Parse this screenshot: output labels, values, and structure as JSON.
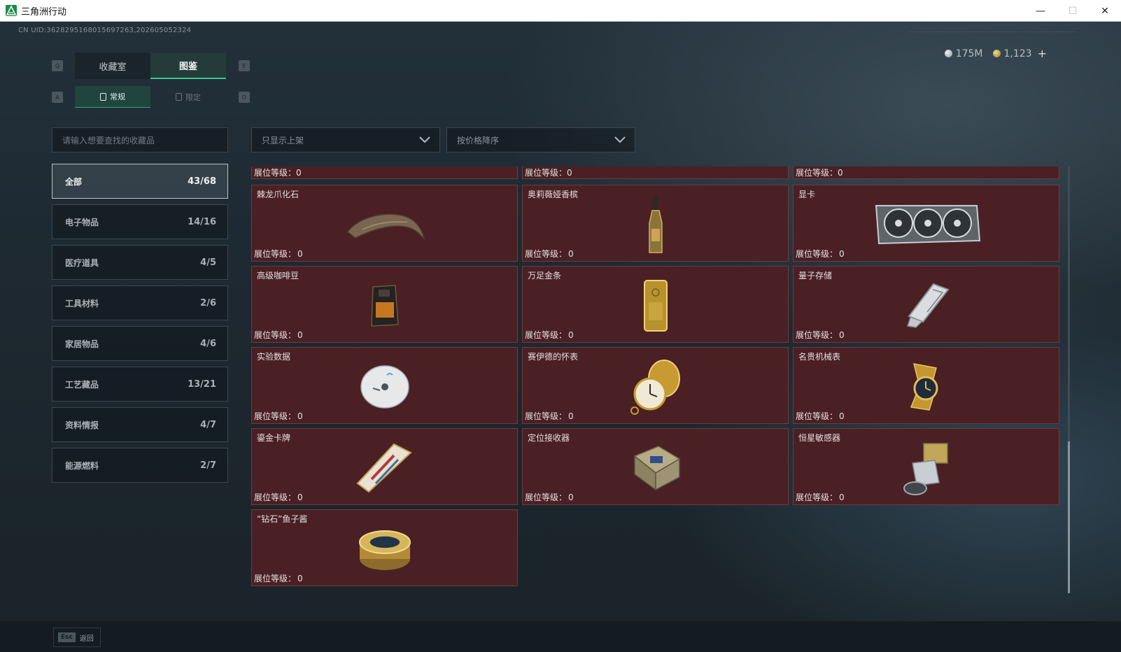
{
  "window": {
    "title": "三角洲行动",
    "minimize": "—",
    "maximize": "☐",
    "close": "✕"
  },
  "uid": "CN UID:3628295168015697263,202605052324",
  "currency": {
    "silver": "175M",
    "gold": "1,123",
    "plus": "+"
  },
  "keys": {
    "q": "Q",
    "e": "E",
    "a": "A",
    "d": "D",
    "esc": "Esc"
  },
  "tabs": {
    "main": [
      "收藏室",
      "图鉴"
    ],
    "sub": [
      "常规",
      "限定"
    ]
  },
  "search": {
    "placeholder": "请输入想要查找的收藏品"
  },
  "filters": {
    "shelf": "只显示上架",
    "sort": "按价格降序"
  },
  "categories": [
    {
      "label": "全部",
      "count": "43/68"
    },
    {
      "label": "电子物品",
      "count": "14/16"
    },
    {
      "label": "医疗道具",
      "count": "4/5"
    },
    {
      "label": "工具材料",
      "count": "2/6"
    },
    {
      "label": "家居物品",
      "count": "4/6"
    },
    {
      "label": "工艺藏品",
      "count": "13/21"
    },
    {
      "label": "资料情报",
      "count": "4/7"
    },
    {
      "label": "能源燃料",
      "count": "2/7"
    }
  ],
  "level_label": "展位等级：",
  "level_value": "0",
  "items": [
    {
      "name": "棘龙爪化石",
      "icon": "claw-fossil-icon"
    },
    {
      "name": "奥莉薇娅香槟",
      "icon": "champagne-icon"
    },
    {
      "name": "显卡",
      "icon": "graphics-card-icon"
    },
    {
      "name": "高级咖啡豆",
      "icon": "coffee-bag-icon"
    },
    {
      "name": "万足金条",
      "icon": "gold-bar-icon"
    },
    {
      "name": "量子存储",
      "icon": "quantum-storage-icon"
    },
    {
      "name": "实验数据",
      "icon": "disc-icon"
    },
    {
      "name": "赛伊德的怀表",
      "icon": "pocket-watch-icon"
    },
    {
      "name": "名贵机械表",
      "icon": "wristwatch-icon"
    },
    {
      "name": "鎏金卡牌",
      "icon": "gilded-card-icon"
    },
    {
      "name": "定位接收器",
      "icon": "gps-receiver-icon"
    },
    {
      "name": "恒星敏感器",
      "icon": "star-sensor-icon"
    },
    {
      "name": "“钻石”鱼子酱",
      "icon": "caviar-tin-icon"
    }
  ],
  "back_label": "返回",
  "colors": {
    "accent": "#35c98c",
    "card_bg": "#4a2024",
    "card_border": "#6f3a3e"
  }
}
